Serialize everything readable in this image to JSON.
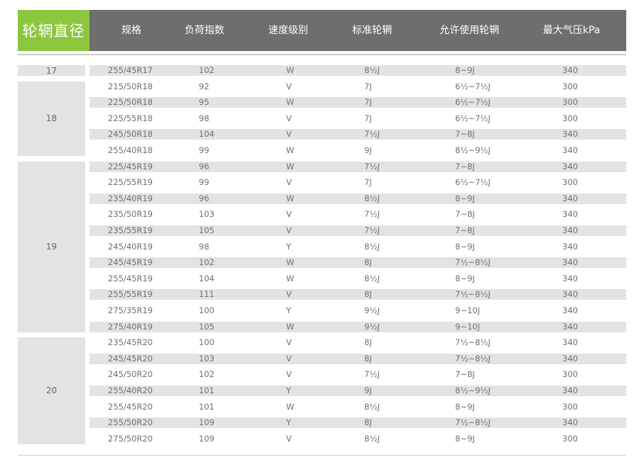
{
  "header": {
    "rim_label": "轮辋直径",
    "columns": [
      "规格",
      "负荷指数",
      "速度级别",
      "标准轮辋",
      "允许使用轮辋",
      "最大气压kPa"
    ]
  },
  "colors": {
    "accent_green": "#8cc63f",
    "header_gray": "#6e6e6e",
    "row_shade": "#e3e3e3",
    "text": "#707070"
  },
  "groups": [
    {
      "label": "17",
      "rows": [
        [
          "255/45R17",
          "102",
          "W",
          "8½J",
          "8~9J",
          "340"
        ]
      ]
    },
    {
      "label": "18",
      "rows": [
        [
          "215/50R18",
          "92",
          "V",
          "7J",
          "6½~7½J",
          "300"
        ],
        [
          "225/50R18",
          "95",
          "W",
          "7J",
          "6½~7½J",
          "300"
        ],
        [
          "225/55R18",
          "98",
          "V",
          "7J",
          "6½~7½J",
          "300"
        ],
        [
          "245/50R18",
          "104",
          "V",
          "7½J",
          "7~8J",
          "340"
        ],
        [
          "255/40R18",
          "99",
          "W",
          "9J",
          "8½~9½J",
          "340"
        ]
      ]
    },
    {
      "label": "19",
      "rows": [
        [
          "225/45R19",
          "96",
          "W",
          "7½J",
          "7~8J",
          "340"
        ],
        [
          "225/55R19",
          "99",
          "V",
          "7J",
          "6½~7½J",
          "300"
        ],
        [
          "235/40R19",
          "96",
          "W",
          "8½J",
          "8~9J",
          "340"
        ],
        [
          "235/50R19",
          "103",
          "V",
          "7½J",
          "7~8J",
          "340"
        ],
        [
          "235/55R19",
          "105",
          "V",
          "7½J",
          "7~8J",
          "340"
        ],
        [
          "245/40R19",
          "98",
          "Y",
          "8½J",
          "8~9J",
          "340"
        ],
        [
          "245/45R19",
          "102",
          "W",
          "8J",
          "7½~8½J",
          "340"
        ],
        [
          "255/45R19",
          "104",
          "W",
          "8½J",
          "8~9J",
          "340"
        ],
        [
          "255/55R19",
          "111",
          "V",
          "8J",
          "7½~8½J",
          "340"
        ],
        [
          "275/35R19",
          "100",
          "Y",
          "9½J",
          "9~10J",
          "340"
        ],
        [
          "275/40R19",
          "105",
          "W",
          "9½J",
          "9~10J",
          "340"
        ]
      ]
    },
    {
      "label": "20",
      "rows": [
        [
          "235/45R20",
          "100",
          "V",
          "8J",
          "7½~8½J",
          "340"
        ],
        [
          "245/45R20",
          "103",
          "V",
          "8J",
          "7½~8½J",
          "340"
        ],
        [
          "245/50R20",
          "102",
          "V",
          "7½J",
          "7~8J",
          "300"
        ],
        [
          "255/40R20",
          "101",
          "Y",
          "9J",
          "8½~9½J",
          "340"
        ],
        [
          "255/45R20",
          "101",
          "W",
          "8½J",
          "8~9J",
          "300"
        ],
        [
          "255/50R20",
          "109",
          "Y",
          "8J",
          "7½~8½J",
          "340"
        ],
        [
          "275/50R20",
          "109",
          "V",
          "8½J",
          "8~9J",
          "300"
        ]
      ]
    }
  ]
}
